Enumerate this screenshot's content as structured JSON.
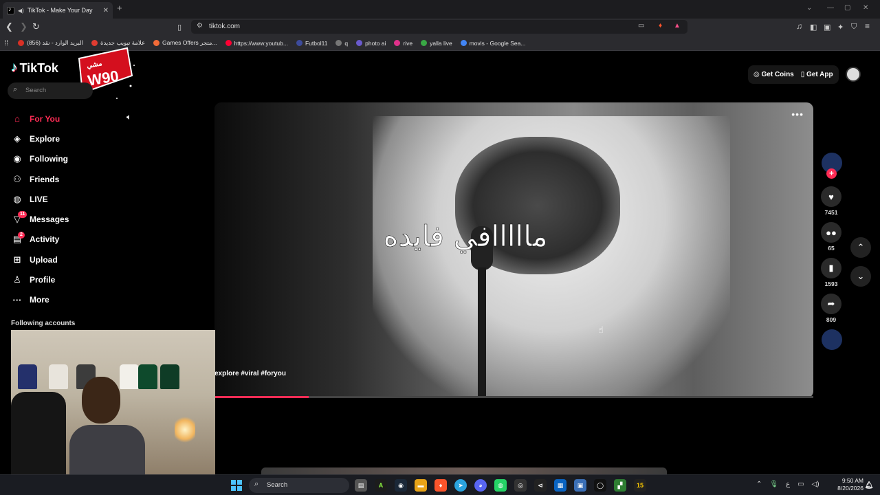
{
  "browser": {
    "tab_title": "TikTok - Make Your Day",
    "url": "tiktok.com",
    "bookmarks": [
      {
        "label": "(856) البريد الوارد - نقد",
        "color": "#d93025"
      },
      {
        "label": "علامة تبويب جديدة",
        "color": "#e03c31"
      },
      {
        "label": "Games Offers متجر...",
        "color": "#f26b38"
      },
      {
        "label": "https://www.youtub...",
        "color": "#ff0033"
      },
      {
        "label": "Futbol11",
        "color": "#3d4b9c"
      },
      {
        "label": "q",
        "color": "#777777"
      },
      {
        "label": "photo ai",
        "color": "#6a5acd"
      },
      {
        "label": "rive",
        "color": "#e0318b"
      },
      {
        "label": "yalla live",
        "color": "#39a845"
      },
      {
        "label": "movis - Google Sea...",
        "color": "#4285f4"
      }
    ]
  },
  "tiktok": {
    "logo": "TikTok",
    "search_placeholder": "Search",
    "nav": [
      {
        "label": "For You",
        "icon": "home-icon"
      },
      {
        "label": "Explore",
        "icon": "compass-icon"
      },
      {
        "label": "Following",
        "icon": "following-icon"
      },
      {
        "label": "Friends",
        "icon": "friends-icon"
      },
      {
        "label": "LIVE",
        "icon": "live-icon"
      },
      {
        "label": "Messages",
        "icon": "messages-icon",
        "badge": "11"
      },
      {
        "label": "Activity",
        "icon": "activity-icon",
        "badge": "2"
      },
      {
        "label": "Upload",
        "icon": "upload-icon"
      },
      {
        "label": "Profile",
        "icon": "profile-icon"
      },
      {
        "label": "More",
        "icon": "more-icon"
      }
    ],
    "following_accounts_title": "Following accounts",
    "get_coins": "Get Coins",
    "get_app": "Get App",
    "video": {
      "caption_overlay": "مااااافي فايده",
      "hashtags": "explore #viral #foryou",
      "progress_fraction": 0.157,
      "likes": "7451",
      "comments": "65",
      "saves": "1593",
      "shares": "809"
    },
    "accent_color": "#fe2c55"
  },
  "taskbar": {
    "search_label": "Search",
    "tray_lang": "ع",
    "time": "9:50 AM",
    "date": "8/20/2026"
  }
}
